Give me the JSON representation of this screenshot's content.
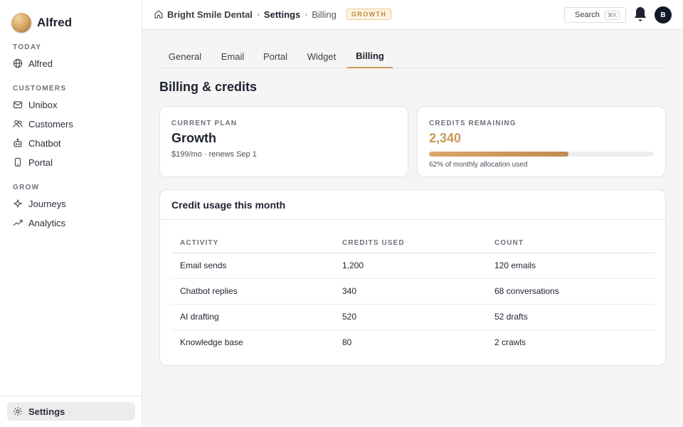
{
  "app": {
    "name": "Alfred"
  },
  "sidebar": {
    "sections": [
      {
        "label": "TODAY",
        "items": [
          {
            "label": "Alfred",
            "icon": "globe-icon"
          }
        ]
      },
      {
        "label": "CUSTOMERS",
        "items": [
          {
            "label": "Unibox",
            "icon": "inbox-icon"
          },
          {
            "label": "Customers",
            "icon": "users-icon"
          },
          {
            "label": "Chatbot",
            "icon": "bot-icon"
          },
          {
            "label": "Portal",
            "icon": "phone-icon"
          }
        ]
      },
      {
        "label": "GROW",
        "items": [
          {
            "label": "Journeys",
            "icon": "sparkle-icon"
          },
          {
            "label": "Analytics",
            "icon": "trend-icon"
          }
        ]
      }
    ],
    "footer_item": {
      "label": "Settings",
      "icon": "gear-icon",
      "active": true
    }
  },
  "topbar": {
    "breadcrumb": [
      "Bright Smile Dental",
      "Settings",
      "Billing"
    ],
    "plan_badge": "GROWTH",
    "search_label": "Search",
    "search_shortcut": "⌘K",
    "avatar_initial": "B"
  },
  "tabs": [
    {
      "label": "General",
      "active": false
    },
    {
      "label": "Email",
      "active": false
    },
    {
      "label": "Portal",
      "active": false
    },
    {
      "label": "Widget",
      "active": false
    },
    {
      "label": "Billing",
      "active": true
    }
  ],
  "page_title": "Billing & credits",
  "plan_card": {
    "caption": "CURRENT PLAN",
    "name": "Growth",
    "details": "$199/mo · renews Sep 1"
  },
  "credits_card": {
    "caption": "CREDITS REMAINING",
    "value": "2,340",
    "used_fraction": 0.62,
    "note": "62% of monthly allocation used"
  },
  "usage": {
    "title": "Credit usage this month",
    "columns": [
      "ACTIVITY",
      "CREDITS USED",
      "COUNT"
    ],
    "rows": [
      [
        "Email sends",
        "1,200",
        "120 emails"
      ],
      [
        "Chatbot replies",
        "340",
        "68 conversations"
      ],
      [
        "AI drafting",
        "520",
        "52 drafts"
      ],
      [
        "Knowledge base",
        "80",
        "2 crawls"
      ]
    ]
  },
  "colors": {
    "accent": "#c99a5b",
    "badge_bg": "#fdf3e2",
    "avatar_bg": "#111827"
  }
}
